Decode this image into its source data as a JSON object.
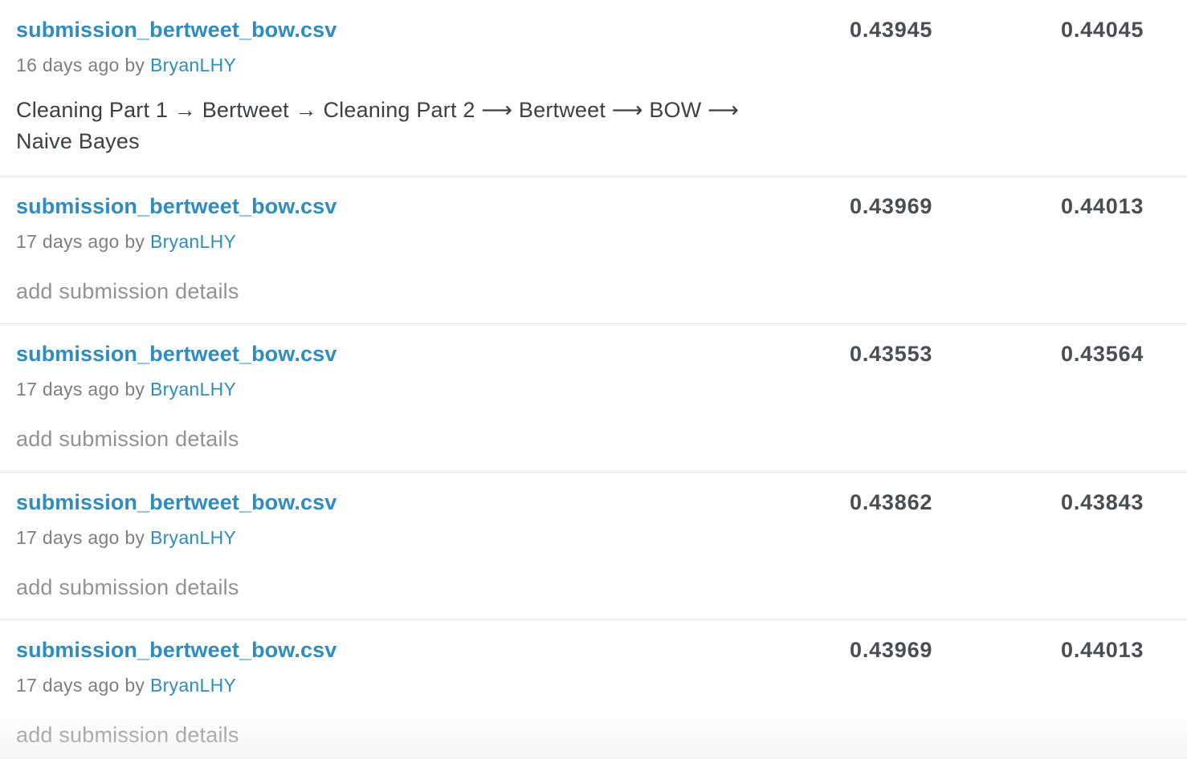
{
  "submissions": [
    {
      "filename": "submission_bertweet_bow.csv",
      "age": "16 days ago",
      "by": "by",
      "user": "BryanLHY",
      "details": "Cleaning Part 1 → Bertweet → Cleaning Part 2 ⟶ Bertweet ⟶ BOW ⟶ Naive Bayes",
      "private_score": "0.43945",
      "public_score": "0.44045"
    },
    {
      "filename": "submission_bertweet_bow.csv",
      "age": "17 days ago",
      "by": "by",
      "user": "BryanLHY",
      "details": "add submission details",
      "private_score": "0.43969",
      "public_score": "0.44013"
    },
    {
      "filename": "submission_bertweet_bow.csv",
      "age": "17 days ago",
      "by": "by",
      "user": "BryanLHY",
      "details": "add submission details",
      "private_score": "0.43553",
      "public_score": "0.43564"
    },
    {
      "filename": "submission_bertweet_bow.csv",
      "age": "17 days ago",
      "by": "by",
      "user": "BryanLHY",
      "details": "add submission details",
      "private_score": "0.43862",
      "public_score": "0.43843"
    },
    {
      "filename": "submission_bertweet_bow.csv",
      "age": "17 days ago",
      "by": "by",
      "user": "BryanLHY",
      "details": "add submission details",
      "private_score": "0.43969",
      "public_score": "0.44013"
    }
  ]
}
